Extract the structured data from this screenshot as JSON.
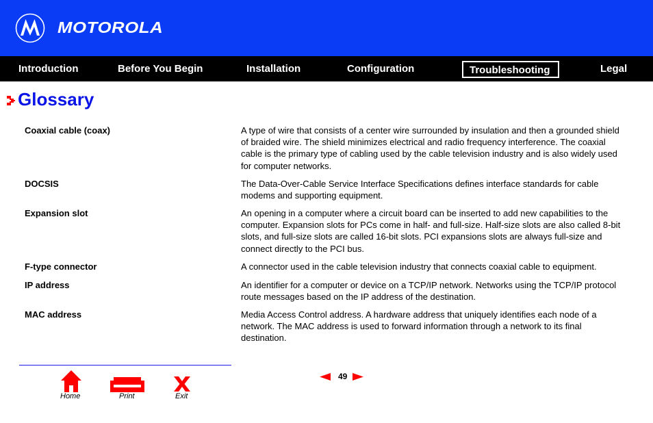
{
  "header": {
    "brand": "MOTOROLA",
    "brand_color": "#0a3cf5"
  },
  "nav": {
    "items": [
      {
        "label": "Introduction",
        "active": false
      },
      {
        "label": "Before You Begin",
        "active": false
      },
      {
        "label": "Installation",
        "active": false
      },
      {
        "label": "Configuration",
        "active": false
      },
      {
        "label": "Troubleshooting",
        "active": true
      },
      {
        "label": "Legal",
        "active": false
      }
    ]
  },
  "page": {
    "title": "Glossary",
    "title_color": "#0a14e6",
    "marker_icon": "red-arrow-bullet-icon"
  },
  "glossary": [
    {
      "term": "Coaxial cable (coax)",
      "definition": "A type of wire that consists of a center wire surrounded by insulation and then a grounded shield of braided wire. The shield minimizes electrical and radio frequency interference. The coaxial cable is the primary type of cabling used by the cable television industry and is also widely used for computer networks."
    },
    {
      "term": "DOCSIS",
      "definition": "The Data-Over-Cable Service Interface Specifications defines interface standards for cable modems and supporting equipment."
    },
    {
      "term": "Expansion slot",
      "definition": "An opening in a computer where a circuit board can be inserted to add new capabilities to the computer. Expansion slots for PCs come in half- and full-size. Half-size slots are also called 8-bit slots, and full-size slots are called 16-bit slots. PCI expansions slots are always full-size and connect directly to the PCI bus."
    },
    {
      "term": "F-type connector",
      "definition": "A connector used in the cable television industry that connects coaxial cable to equipment."
    },
    {
      "term": "IP address",
      "definition": "An identifier for a computer or device on a TCP/IP network. Networks using the TCP/IP protocol route messages based on the IP address of the destination."
    },
    {
      "term": "MAC address",
      "definition": "Media Access Control address. A hardware address that uniquely identifies each node of a network. The MAC address is used to forward information through a network to its final destination."
    }
  ],
  "footer": {
    "home_label": "Home",
    "print_label": "Print",
    "exit_label": "Exit",
    "page_number": "49",
    "accent_color": "#ff0000"
  }
}
